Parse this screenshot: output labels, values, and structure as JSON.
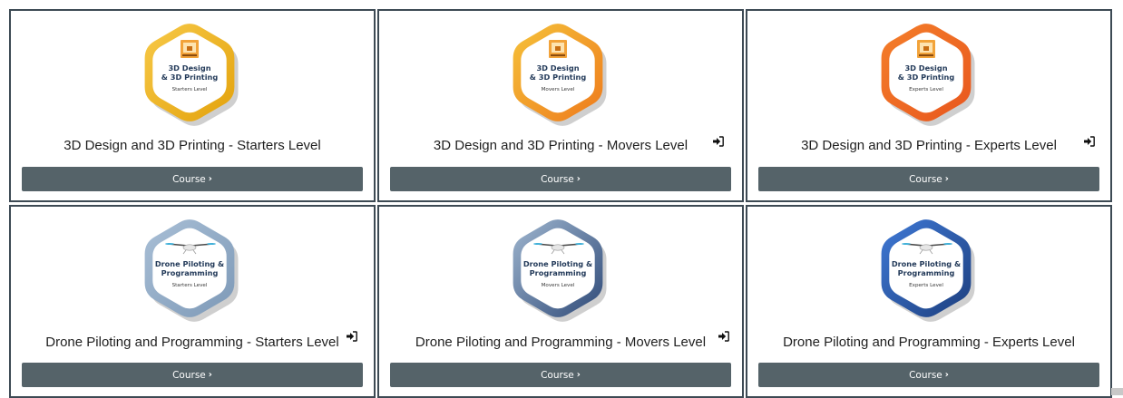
{
  "courses": [
    {
      "title": "3D Design and 3D Printing - Starters Level",
      "badge_line1": "3D Design",
      "badge_line2": "& 3D Printing",
      "badge_level": "Starters Level",
      "badge_icon": "3d-printer-icon",
      "badge_colors": [
        "#f7c948",
        "#e3a20c"
      ],
      "enrol_icon": false,
      "button_label": "Course"
    },
    {
      "title": "3D Design and 3D Printing - Movers Level",
      "badge_line1": "3D Design",
      "badge_line2": "& 3D Printing",
      "badge_level": "Movers Level",
      "badge_icon": "3d-printer-icon",
      "badge_colors": [
        "#f5c23a",
        "#ee7a1c"
      ],
      "enrol_icon": true,
      "button_label": "Course"
    },
    {
      "title": "3D Design and 3D Printing - Experts Level",
      "badge_line1": "3D Design",
      "badge_line2": "& 3D Printing",
      "badge_level": "Experts Level",
      "badge_icon": "3d-printer-icon",
      "badge_colors": [
        "#f47f2a",
        "#e8561e"
      ],
      "enrol_icon": true,
      "button_label": "Course"
    },
    {
      "title": "Drone Piloting and Programming - Starters Level",
      "badge_line1": "Drone Piloting &",
      "badge_line2": "Programming",
      "badge_level": "Starters Level",
      "badge_icon": "drone-icon",
      "badge_colors": [
        "#a9bfd6",
        "#7d99b7"
      ],
      "enrol_icon": true,
      "button_label": "Course"
    },
    {
      "title": "Drone Piloting and Programming - Movers Level",
      "badge_line1": "Drone Piloting &",
      "badge_line2": "Programming",
      "badge_level": "Movers Level",
      "badge_icon": "drone-icon",
      "badge_colors": [
        "#9fb6cf",
        "#2f4a78"
      ],
      "enrol_icon": true,
      "button_label": "Course"
    },
    {
      "title": "Drone Piloting and Programming - Experts Level",
      "badge_line1": "Drone Piloting &",
      "badge_line2": "Programming",
      "badge_level": "Experts Level",
      "badge_icon": "drone-icon",
      "badge_colors": [
        "#3f79d6",
        "#1d3f7e"
      ],
      "enrol_icon": false,
      "button_label": "Course"
    }
  ]
}
